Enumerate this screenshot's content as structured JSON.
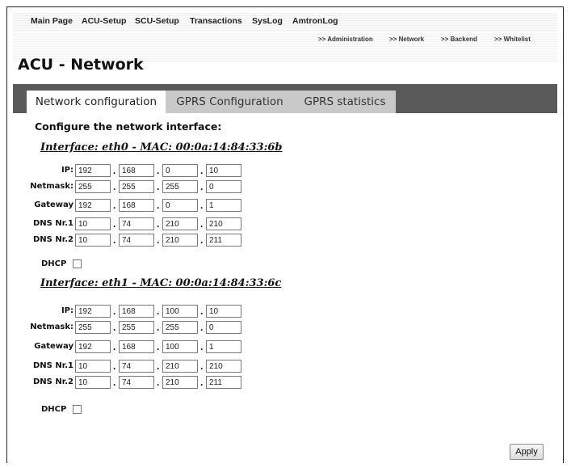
{
  "topmenu": {
    "items": [
      "Main Page",
      "ACU-Setup",
      "SCU-Setup",
      "Transactions",
      "SysLog",
      "AmtronLog"
    ]
  },
  "submenu": {
    "items": [
      ">> Administration",
      ">> Network",
      ">> Backend",
      ">> Whitelist"
    ]
  },
  "page_title": "ACU - Network",
  "tabs": [
    "Network configuration",
    "GPRS Configuration",
    "GPRS statistics"
  ],
  "active_tab": "Network configuration",
  "section_title": "Configure the network interface:",
  "labels": {
    "ip": "IP:",
    "netmask": "Netmask:",
    "gateway": "Gateway",
    "dns1": "DNS Nr.1",
    "dns2": "DNS Nr.2",
    "dhcp": "DHCP"
  },
  "interfaces": [
    {
      "title": "Interface: eth0 - MAC: 00:0a:14:84:33:6b",
      "ip": [
        "192",
        "168",
        "0",
        "10"
      ],
      "netmask": [
        "255",
        "255",
        "255",
        "0"
      ],
      "gateway": [
        "192",
        "168",
        "0",
        "1"
      ],
      "dns1": [
        "10",
        "74",
        "210",
        "210"
      ],
      "dns2": [
        "10",
        "74",
        "210",
        "211"
      ],
      "dhcp": false
    },
    {
      "title": "Interface: eth1 - MAC: 00:0a:14:84:33:6c",
      "ip": [
        "192",
        "168",
        "100",
        "10"
      ],
      "netmask": [
        "255",
        "255",
        "255",
        "0"
      ],
      "gateway": [
        "192",
        "168",
        "100",
        "1"
      ],
      "dns1": [
        "10",
        "74",
        "210",
        "210"
      ],
      "dns2": [
        "10",
        "74",
        "210",
        "211"
      ],
      "dhcp": false
    }
  ],
  "apply_label": "Apply",
  "colors": {
    "tabbar": "#5a5a5a",
    "tab_inactive": "#c9c9c9",
    "tab_active": "#ffffff"
  }
}
